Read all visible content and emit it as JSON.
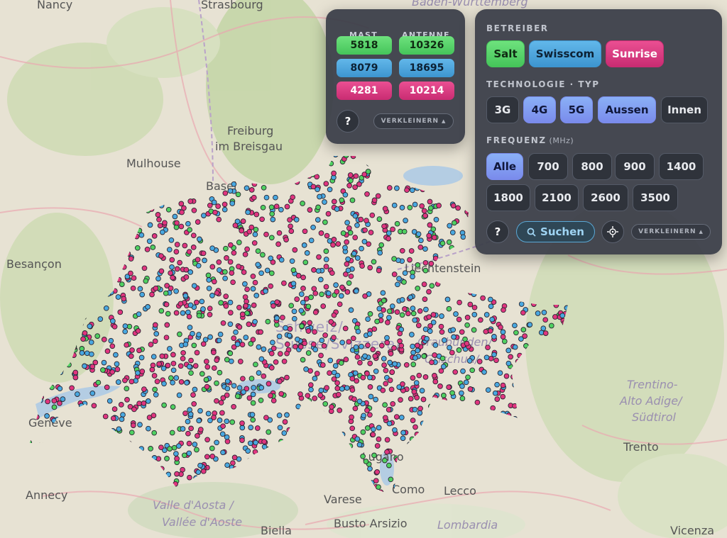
{
  "colors": {
    "salt": "#4fd061",
    "swisscom": "#49a8e0",
    "sunrise": "#e0357f",
    "panel": "#3a3e48"
  },
  "map": {
    "labels": {
      "nancy": "Nancy",
      "strasbourg": "Strasbourg",
      "baden": "Baden-Württemberg",
      "freiburg1": "Freiburg",
      "freiburg2": "im Breisgau",
      "mulhouse": "Mulhouse",
      "basel": "Basel",
      "besancon": "Besançon",
      "liechtenstein": "Liechtenstein",
      "schweiz": "Schweiz/",
      "suisse": "Suisse/Svizzera/",
      "graubunden1": "Graubünden/",
      "graubunden2": "Grischun/",
      "trentino1": "Trentino-",
      "trentino2": "Alto Adige/",
      "trentino3": "Südtirol",
      "trento": "Trento",
      "geneve": "Genève",
      "annecy": "Annecy",
      "aosta1": "Valle d'Aosta /",
      "aosta2": "Vallée d'Aoste",
      "biella": "Biella",
      "varese": "Varese",
      "lugano": "Lugano",
      "como": "Como",
      "lecco": "Lecco",
      "busto": "Busto Arsizio",
      "lombardia": "Lombardia",
      "vicenza": "Vicenza"
    }
  },
  "counts": {
    "mast_header": "MAST",
    "antenne_header": "ANTENNE",
    "salt": {
      "mast": "5818",
      "antenne": "10326"
    },
    "swisscom": {
      "mast": "8079",
      "antenne": "18695"
    },
    "sunrise": {
      "mast": "4281",
      "antenne": "10214"
    },
    "help_label": "?",
    "collapse_label": "VERKLEINERN"
  },
  "filters": {
    "betreiber_header": "BETREIBER",
    "operators": [
      "Salt",
      "Swisscom",
      "Sunrise"
    ],
    "tech_header": "TECHNOLOGIE · TYP",
    "technologies": [
      "3G",
      "4G",
      "5G",
      "Aussen",
      "Innen"
    ],
    "freq_header": "FREQUENZ",
    "freq_unit": "(MHz)",
    "frequencies": [
      "Alle",
      "700",
      "800",
      "900",
      "1400",
      "1800",
      "2100",
      "2600",
      "3500"
    ],
    "help_label": "?",
    "search_label": "Suchen",
    "collapse_label": "VERKLEINERN"
  }
}
